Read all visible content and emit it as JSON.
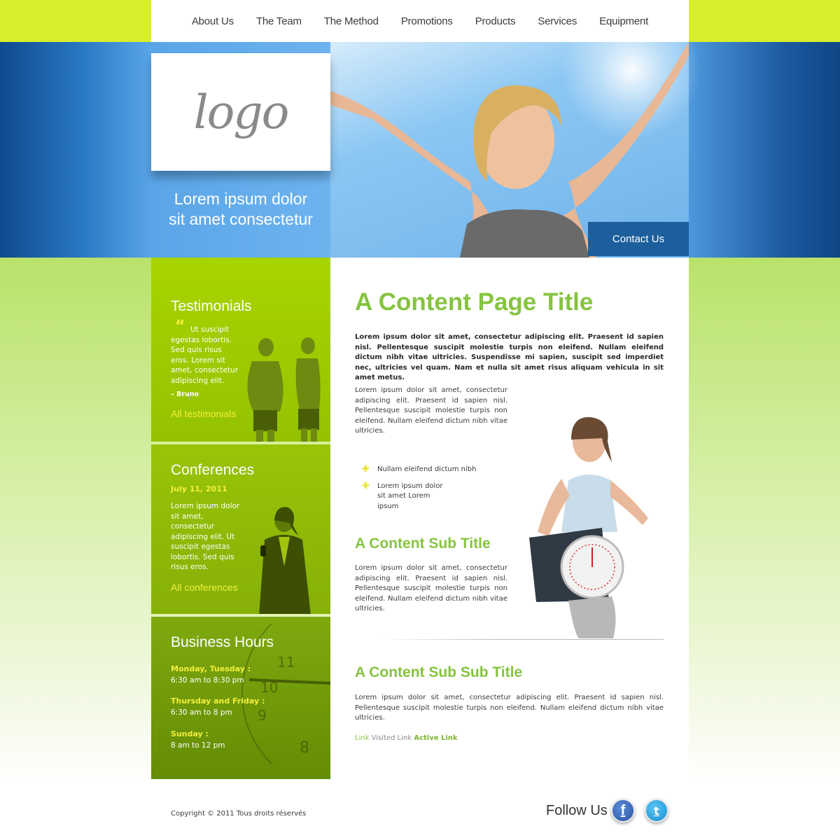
{
  "nav": {
    "items": [
      "About Us",
      "The Team",
      "The Method",
      "Promotions",
      "Products",
      "Services",
      "Equipment"
    ]
  },
  "hero": {
    "logo": "logo",
    "tagline_line1": "Lorem ipsum dolor",
    "tagline_line2": "sit amet consectetur",
    "contact_button": "Contact Us"
  },
  "sidebar": {
    "testimonials": {
      "title": "Testimonials",
      "quote_mark": "“",
      "text": "Ut suscipit egestas lobortis. Sed quis risus eros. Lorem sit amet, consectetur adipiscing elit.",
      "author": "– Bruno",
      "link": "All testimonials"
    },
    "conferences": {
      "title": "Conferences",
      "date": "July 11, 2011",
      "text": "Lorem ipsum dolor sit amet, consectetur adipiscing elit. Ut suscipit egestas lobortis. Sed quis risus eros.",
      "link": "All conferences"
    },
    "hours": {
      "title": "Business Hours",
      "entries": [
        {
          "day": "Monday, Tuesday :",
          "time": "6:30 am to 8:30 pm"
        },
        {
          "day": "Thursday and Friday :",
          "time": "6:30 am to 8 pm"
        },
        {
          "day": "Sunday :",
          "time": "8 am to 12 pm"
        }
      ],
      "clock_numbers": [
        "11",
        "10",
        "9",
        "8"
      ]
    }
  },
  "main": {
    "title": "A Content Page Title",
    "lead": "Lorem ipsum dolor sit amet, consectetur adipiscing elit. Praesent id sapien nisl. Pellentesque suscipit molestie turpis non eleifend. Nullam eleifend dictum nibh vitae ultricies. Suspendisse mi sapien, suscipit sed imperdiet nec, ultricies vel quam. Nam et nulla sit amet risus aliquam vehicula in sit amet metus.",
    "para1": "Lorem ipsum dolor sit amet, consectetur adipiscing elit. Praesent id sapien nisl. Pellentesque suscipit molestie turpis non eleifend. Nullam eleifend dictum nibh vitae ultricies.",
    "bullets": [
      "Nullam eleifend dictum nibh",
      "Lorem ipsum dolor sit amet Lorem ipsum"
    ],
    "sub_title": "A Content Sub Title",
    "para2": "Lorem ipsum dolor sit amet, consectetur adipiscing elit. Praesent id sapien nisl. Pellentesque suscipit molestie turpis non eleifend. Nullam eleifend dictum nibh vitae ultricies.",
    "sub_sub_title": "A Content Sub Sub Title",
    "para3": "Lorem ipsum dolor sit amet, consectetur adipiscing elit. Praesent id sapien nisl. Pellentesque suscipit molestie turpis non eleifend. Nullam eleifend dictum nibh vitae ultricies.",
    "links": {
      "link": "Link",
      "visited": "Visited Link",
      "active": "Active Link"
    }
  },
  "footer": {
    "copyright": "Copyright © 2011 Tous droits réservés",
    "follow": "Follow Us",
    "facebook_glyph": "f",
    "twitter_glyph": "t"
  },
  "colors": {
    "lime": "#d8ee2c",
    "green_title": "#86c440",
    "yellow_link": "#f4ef3a",
    "blue_button": "#1d5f9c"
  },
  "icons": [
    "facebook-icon",
    "twitter-icon",
    "quote-icon",
    "plus-bullet-icon",
    "clock-icon"
  ]
}
